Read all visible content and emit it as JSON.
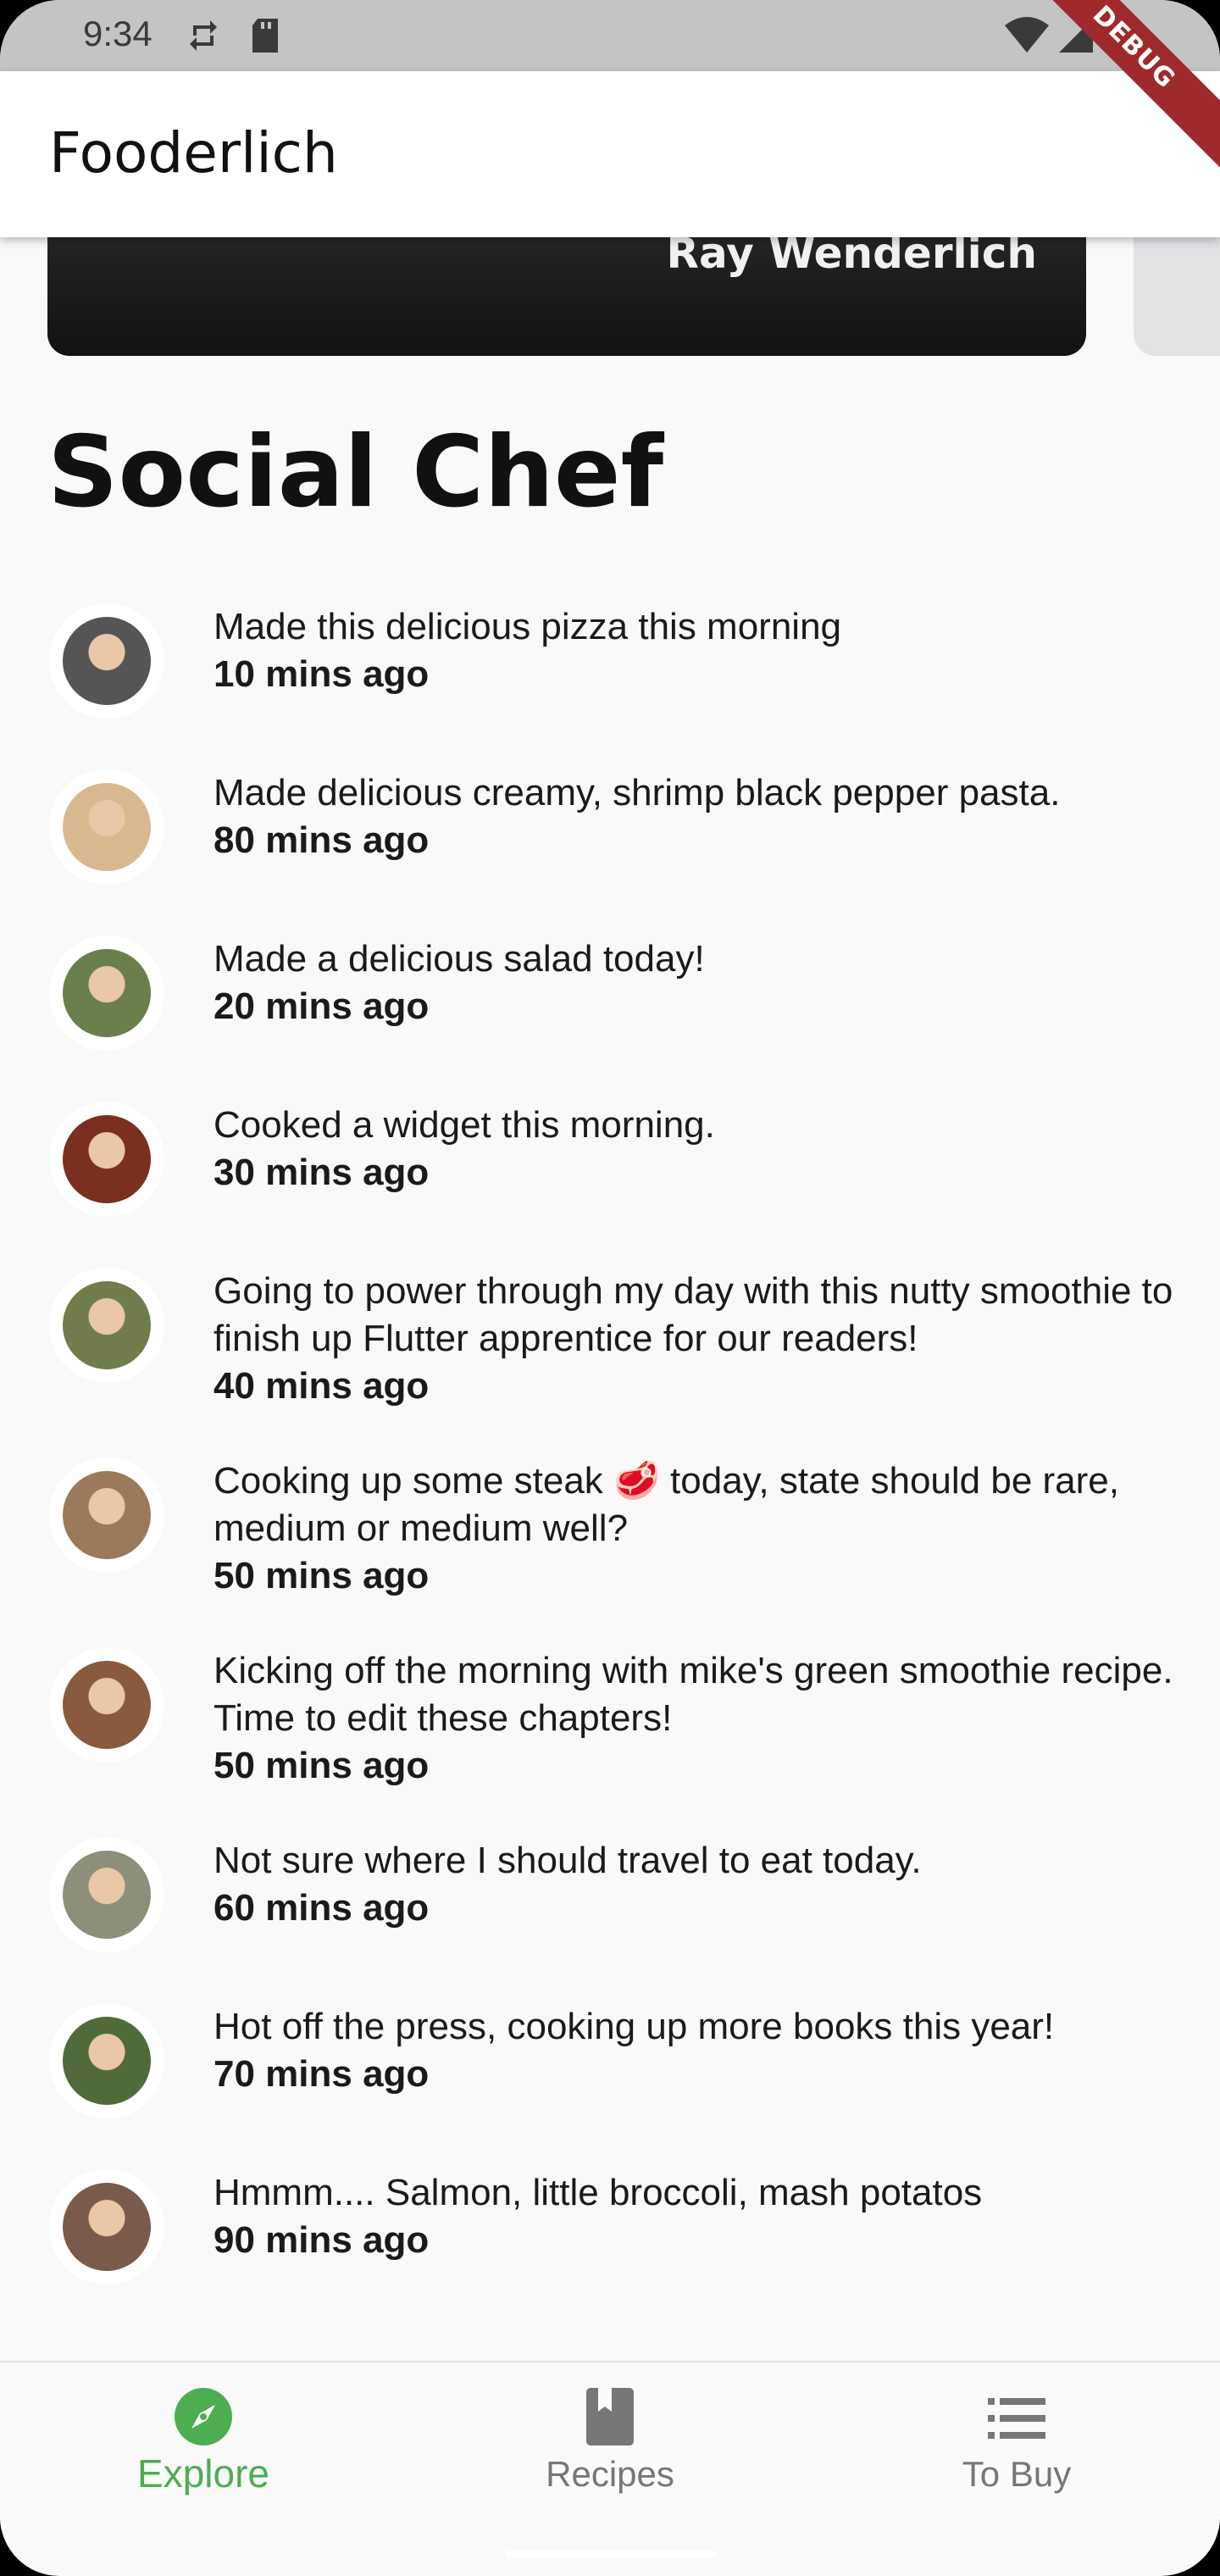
{
  "status_bar": {
    "time": "9:34",
    "icons": [
      "sync-icon",
      "sd-card-icon",
      "wifi-icon",
      "signal-icon",
      "battery-icon"
    ]
  },
  "debug_banner": "DEBUG",
  "app_bar": {
    "title": "Fooderlich"
  },
  "featured_card": {
    "author": "Ray Wenderlich"
  },
  "section_title": "Social Chef",
  "feed": [
    {
      "text": "Made this delicious pizza this morning",
      "time": "10  mins ago",
      "avatar_color": "#555"
    },
    {
      "text": "Made delicious creamy, shrimp black pepper pasta.",
      "time": "80  mins ago",
      "avatar_color": "#d8b98f"
    },
    {
      "text": "Made a delicious salad today!",
      "time": "20  mins ago",
      "avatar_color": "#6b7f4c"
    },
    {
      "text": "Cooked a widget this morning.",
      "time": "30  mins ago",
      "avatar_color": "#7a2f1f"
    },
    {
      "text": "Going to power through my day with this nutty smoothie to finish up Flutter apprentice for our readers!",
      "time": "40  mins ago",
      "avatar_color": "#6f7d4a"
    },
    {
      "text": "Cooking up some steak 🥩 today, state should be rare, medium or medium well?",
      "time": "50  mins ago",
      "avatar_color": "#9a7a5a"
    },
    {
      "text": "Kicking off the morning with mike's green smoothie recipe. Time to edit these chapters!",
      "time": "50  mins ago",
      "avatar_color": "#8a5a3c"
    },
    {
      "text": "Not sure where I should travel to eat today.",
      "time": "60  mins ago",
      "avatar_color": "#8d8f7a"
    },
    {
      "text": "Hot off the press, cooking up more books this year!",
      "time": "70  mins ago",
      "avatar_color": "#4f6b3a"
    },
    {
      "text": "Hmmm.... Salmon, little broccoli, mash potatos",
      "time": "90  mins ago",
      "avatar_color": "#7a5a4a"
    }
  ],
  "bottom_nav": {
    "items": [
      {
        "label": "Explore",
        "icon": "compass-icon",
        "active": true
      },
      {
        "label": "Recipes",
        "icon": "book-icon",
        "active": false
      },
      {
        "label": "To Buy",
        "icon": "list-icon",
        "active": false
      }
    ],
    "active_color": "#4cae50",
    "inactive_color": "#777777"
  }
}
